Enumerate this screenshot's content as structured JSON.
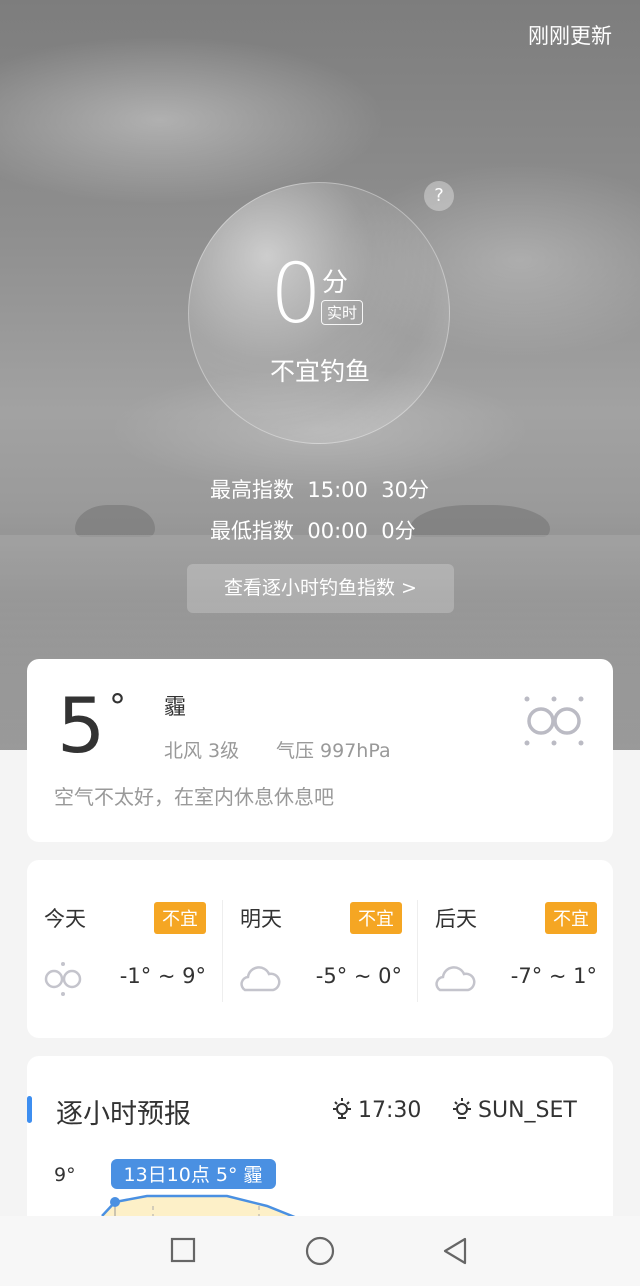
{
  "header": {
    "updated_label": "刚刚更新"
  },
  "index": {
    "score": "0",
    "unit": "分",
    "realtime_label": "实时",
    "verdict": "不宜钓鱼",
    "max": {
      "label": "最高指数",
      "time": "15:00",
      "value": "30分"
    },
    "min": {
      "label": "最低指数",
      "time": "00:00",
      "value": "0分"
    },
    "hourly_button": "查看逐小时钓鱼指数 >"
  },
  "weather": {
    "temp": "5",
    "deg": "°",
    "condition": "霾",
    "wind": "北风  3级",
    "pressure": "气压  997hPa",
    "advice": "空气不太好，在室内休息休息吧",
    "icon": "haze-icon"
  },
  "forecast": [
    {
      "name": "今天",
      "badge": "不宜",
      "range": "-1° ~ 9°",
      "icon": "haze-icon"
    },
    {
      "name": "明天",
      "badge": "不宜",
      "range": "-5° ~ 0°",
      "icon": "cloud-icon"
    },
    {
      "name": "后天",
      "badge": "不宜",
      "range": "-7° ~ 1°",
      "icon": "cloud-icon"
    }
  ],
  "hourly": {
    "title": "逐小时预报",
    "sunrise": "17:30",
    "sunset": "SUN_SET",
    "y_label": "9°",
    "tooltip": "13日10点 5° 霾"
  },
  "colors": {
    "accent": "#3d8ef0",
    "badge": "#f5a623",
    "tooltip": "#4a90e2",
    "curve_fill": "#fdf0c8"
  }
}
